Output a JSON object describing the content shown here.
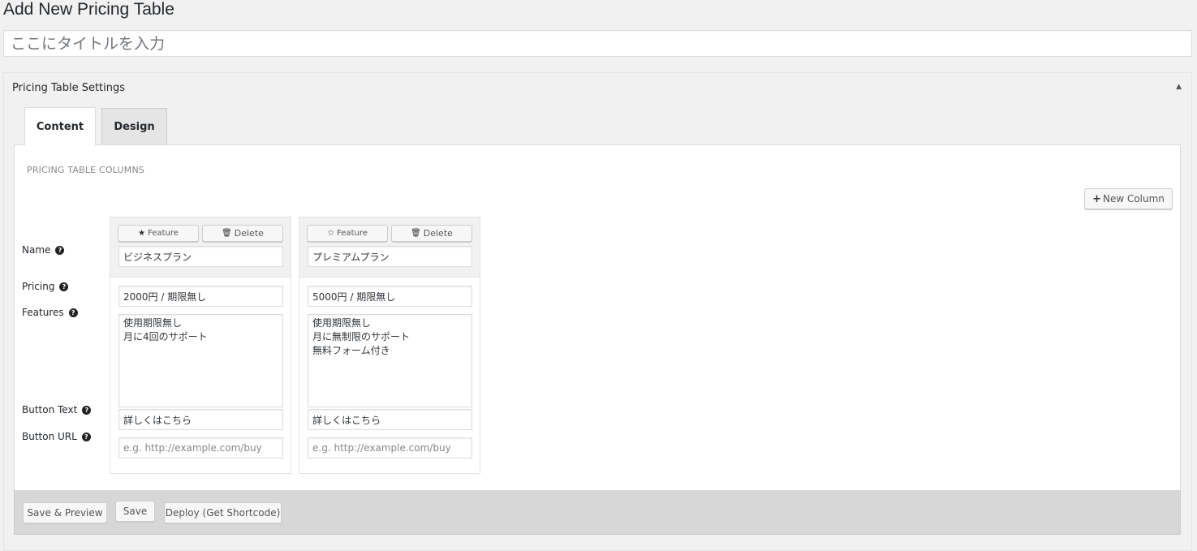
{
  "page": {
    "title": "Add New Pricing Table",
    "title_placeholder": "ここにタイトルを入力"
  },
  "metabox": {
    "title": "Pricing Table Settings",
    "toggle_icon": "▲"
  },
  "tabs": [
    {
      "label": "Content",
      "active": true
    },
    {
      "label": "Design",
      "active": false
    }
  ],
  "section": {
    "heading": "PRICING TABLE COLUMNS",
    "new_column_label": "New Column",
    "new_column_icon": "plus-icon"
  },
  "row_labels": {
    "name": "Name",
    "pricing": "Pricing",
    "features": "Features",
    "button_text": "Button Text",
    "button_url": "Button URL",
    "help_glyph": "?"
  },
  "columns": [
    {
      "feature_label": "Feature",
      "feature_icon": "★",
      "featured": true,
      "delete_label": "Delete",
      "delete_icon": "🗑",
      "name": "ビジネスプラン",
      "pricing": "2000円 / 期限無し",
      "features": "使用期限無し\n月に4回のサポート",
      "button_text": "詳しくはこちら",
      "button_url": "",
      "button_url_placeholder": "e.g. http://example.com/buy"
    },
    {
      "feature_label": "Feature",
      "feature_icon": "☆",
      "featured": false,
      "delete_label": "Delete",
      "delete_icon": "🗑",
      "name": "プレミアムプラン",
      "pricing": "5000円 / 期限無し",
      "features": "使用期限無し\n月に無制限のサポート\n無料フォーム付き",
      "button_text": "詳しくはこちら",
      "button_url": "",
      "button_url_placeholder": "e.g. http://example.com/buy"
    }
  ],
  "footer": {
    "save_preview_label": "Save & Preview",
    "save_label": "Save",
    "deploy_label": "Deploy (Get Shortcode)"
  }
}
